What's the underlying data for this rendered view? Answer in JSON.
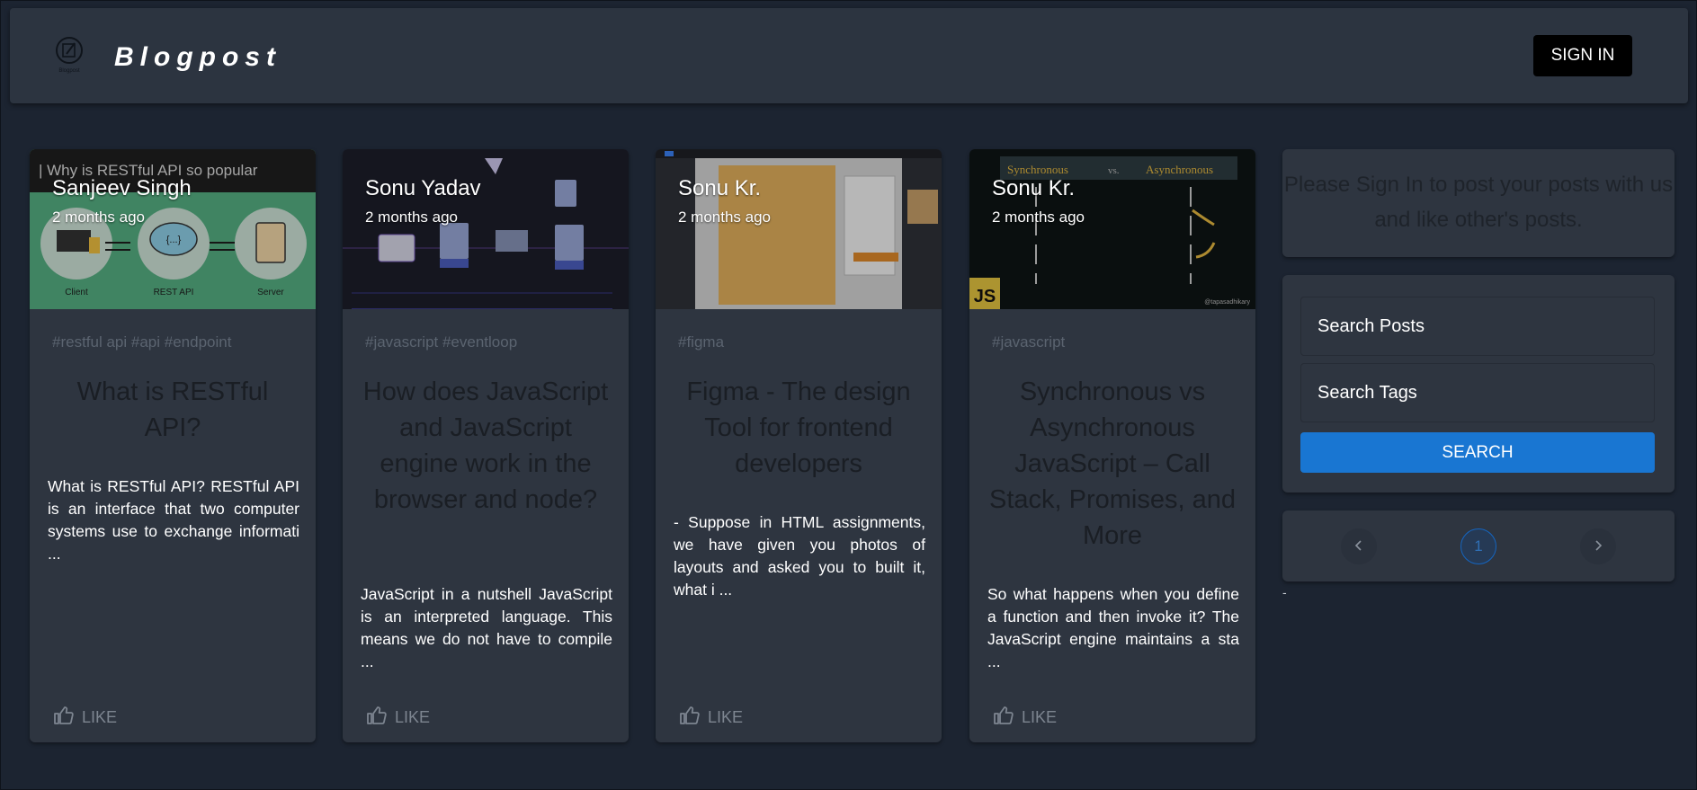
{
  "header": {
    "brand": "Blogpost",
    "logo_caption": "Blogpost",
    "signin_label": "SIGN IN"
  },
  "posts": [
    {
      "author": "Sanjeev Singh",
      "time": "2 months ago",
      "image_caption": "| Why is RESTful API so popular",
      "image_labels": [
        "Client",
        "REST API",
        "Server"
      ],
      "tags": "#restful api #api #endpoint",
      "title": "What is RESTful API?",
      "excerpt": "What is RESTful API? RESTful API is an interface that two computer systems use to exchange informati ...",
      "like_label": "LIKE"
    },
    {
      "author": "Sonu Yadav",
      "time": "2 months ago",
      "tags": "#javascript #eventloop",
      "title": "How does JavaScript and JavaScript engine work in the browser and node?",
      "excerpt": "JavaScript in a nutshell JavaScript is an interpreted language. This means we do not have to compile ...",
      "like_label": "LIKE"
    },
    {
      "author": "Sonu Kr.",
      "time": "2 months ago",
      "tags": "#figma",
      "title": "Figma - The design Tool for frontend developers",
      "excerpt": "- Suppose in HTML assignments, we have given you photos of layouts and asked you to built it, what i ...",
      "like_label": "LIKE"
    },
    {
      "author": "Sonu Kr.",
      "time": "2 months ago",
      "image_labels": [
        "Synchronous",
        "vs.",
        "Asynchronous",
        "JS",
        "@tapasadhikary"
      ],
      "tags": "#javascript",
      "title": "Synchronous vs Asynchronous JavaScript – Call Stack, Promises, and More",
      "excerpt": "So what happens when you define a function and then invoke it? The JavaScript engine maintains a sta ...",
      "like_label": "LIKE"
    }
  ],
  "sidebar": {
    "signin_message": "Please Sign In to post your posts with us and like other's posts.",
    "search_posts_placeholder": "Search Posts",
    "search_tags_placeholder": "Search Tags",
    "search_label": "SEARCH",
    "pagination": {
      "current_page": "1",
      "prev_icon": "chevron-left-icon",
      "next_icon": "chevron-right-icon"
    },
    "footer_dash": "-"
  },
  "colors": {
    "background": "#1c2431",
    "surface": "#2e3540",
    "primary": "#1976d2"
  }
}
